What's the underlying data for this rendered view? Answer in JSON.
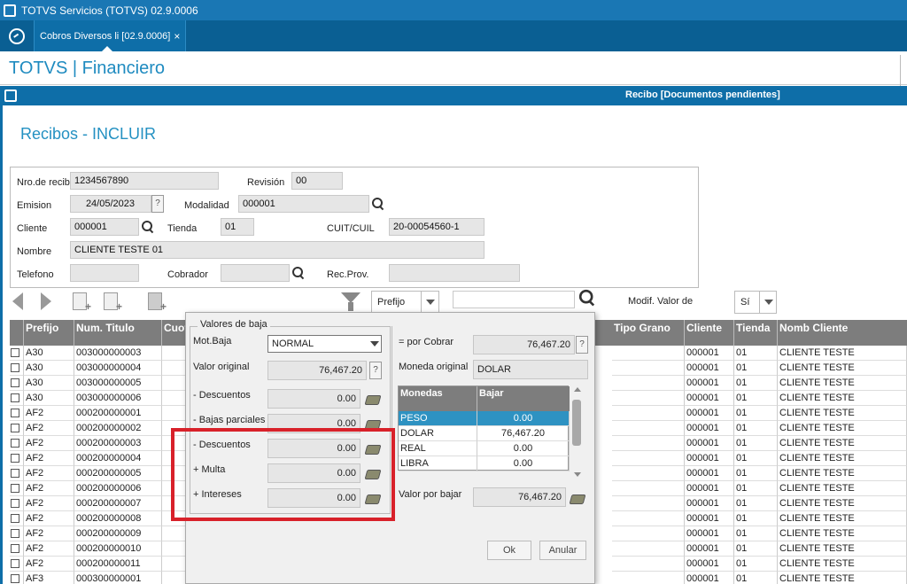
{
  "window": {
    "title": "TOTVS Servicios (TOTVS) 02.9.0006"
  },
  "tab": {
    "label": "Cobros Diversos li [02.9.0006]",
    "close": "×"
  },
  "header": {
    "brand": "TOTVS | Financiero"
  },
  "dialog": {
    "title": "Recibo [Documentos pendientes]"
  },
  "page": {
    "title": "Recibos - INCLUIR"
  },
  "form": {
    "nro_label": "Nro.de recib",
    "nro_value": "1234567890",
    "revision_label": "Revisión",
    "revision_value": "00",
    "emision_label": "Emision",
    "emision_value": "24/05/2023",
    "modalidad_label": "Modalidad",
    "modalidad_value": "000001",
    "cliente_label": "Cliente",
    "cliente_value": "000001",
    "tienda_label": "Tienda",
    "tienda_value": "01",
    "cuit_label": "CUIT/CUIL",
    "cuit_value": "20-00054560-1",
    "nombre_label": "Nombre",
    "nombre_value": "CLIENTE TESTE 01",
    "telefono_label": "Telefono",
    "telefono_value": "",
    "cobrador_label": "Cobrador",
    "cobrador_value": "",
    "recprov_label": "Rec.Prov.",
    "recprov_value": "",
    "help": "?"
  },
  "toolbar": {
    "filter_field": "Prefijo",
    "search_value": "",
    "modif_label": "Modif. Valor de",
    "modif_value": "Sí"
  },
  "grid": {
    "headers_left": [
      "Prefijo",
      "Num. Titulo",
      "Cuot"
    ],
    "headers_right": [
      "Tipo Grano",
      "Cliente",
      "Tienda",
      "Nomb Cliente"
    ],
    "rows": [
      {
        "prefijo": "A30",
        "num": "003000000003",
        "cliente": "000001",
        "tienda": "01",
        "nomb": "CLIENTE TESTE"
      },
      {
        "prefijo": "A30",
        "num": "003000000004",
        "cliente": "000001",
        "tienda": "01",
        "nomb": "CLIENTE TESTE"
      },
      {
        "prefijo": "A30",
        "num": "003000000005",
        "cliente": "000001",
        "tienda": "01",
        "nomb": "CLIENTE TESTE"
      },
      {
        "prefijo": "A30",
        "num": "003000000006",
        "cliente": "000001",
        "tienda": "01",
        "nomb": "CLIENTE TESTE"
      },
      {
        "prefijo": "AF2",
        "num": "000200000001",
        "cliente": "000001",
        "tienda": "01",
        "nomb": "CLIENTE TESTE"
      },
      {
        "prefijo": "AF2",
        "num": "000200000002",
        "cliente": "000001",
        "tienda": "01",
        "nomb": "CLIENTE TESTE"
      },
      {
        "prefijo": "AF2",
        "num": "000200000003",
        "cliente": "000001",
        "tienda": "01",
        "nomb": "CLIENTE TESTE"
      },
      {
        "prefijo": "AF2",
        "num": "000200000004",
        "cliente": "000001",
        "tienda": "01",
        "nomb": "CLIENTE TESTE"
      },
      {
        "prefijo": "AF2",
        "num": "000200000005",
        "cliente": "000001",
        "tienda": "01",
        "nomb": "CLIENTE TESTE"
      },
      {
        "prefijo": "AF2",
        "num": "000200000006",
        "cliente": "000001",
        "tienda": "01",
        "nomb": "CLIENTE TESTE"
      },
      {
        "prefijo": "AF2",
        "num": "000200000007",
        "cliente": "000001",
        "tienda": "01",
        "nomb": "CLIENTE TESTE"
      },
      {
        "prefijo": "AF2",
        "num": "000200000008",
        "cliente": "000001",
        "tienda": "01",
        "nomb": "CLIENTE TESTE"
      },
      {
        "prefijo": "AF2",
        "num": "000200000009",
        "cliente": "000001",
        "tienda": "01",
        "nomb": "CLIENTE TESTE"
      },
      {
        "prefijo": "AF2",
        "num": "000200000010",
        "cliente": "000001",
        "tienda": "01",
        "nomb": "CLIENTE TESTE"
      },
      {
        "prefijo": "AF2",
        "num": "000200000011",
        "cliente": "000001",
        "tienda": "01",
        "nomb": "CLIENTE TESTE"
      },
      {
        "prefijo": "AF3",
        "num": "000300000001",
        "cliente": "000001",
        "tienda": "01",
        "nomb": "CLIENTE TESTE"
      }
    ]
  },
  "popup": {
    "group_title": "Valores de baja",
    "motbaja_label": "Mot.Baja",
    "motbaja_value": "NORMAL",
    "valor_original_label": "Valor original",
    "valor_original_value": "76,467.20",
    "descuentos1_label": "- Descuentos",
    "descuentos1_value": "0.00",
    "bajas_label": "- Bajas parciales",
    "bajas_value": "0.00",
    "descuentos2_label": "- Descuentos",
    "descuentos2_value": "0.00",
    "multa_label": "+ Multa",
    "multa_value": "0.00",
    "intereses_label": "+ Intereses",
    "intereses_value": "0.00",
    "porcobrar_label": "= por Cobrar",
    "porcobrar_value": "76,467.20",
    "moneda_label": "Moneda original",
    "moneda_value": "DOLAR",
    "monedas_header": "Monedas",
    "bajar_header": "Bajar",
    "monedas": [
      {
        "name": "PESO",
        "value": "0.00"
      },
      {
        "name": "DOLAR",
        "value": "76,467.20"
      },
      {
        "name": "REAL",
        "value": "0.00"
      },
      {
        "name": "LIBRA",
        "value": "0.00"
      }
    ],
    "valor_bajar_label": "Valor por bajar",
    "valor_bajar_value": "76,467.20",
    "ok": "Ok",
    "cancel": "Anular"
  }
}
